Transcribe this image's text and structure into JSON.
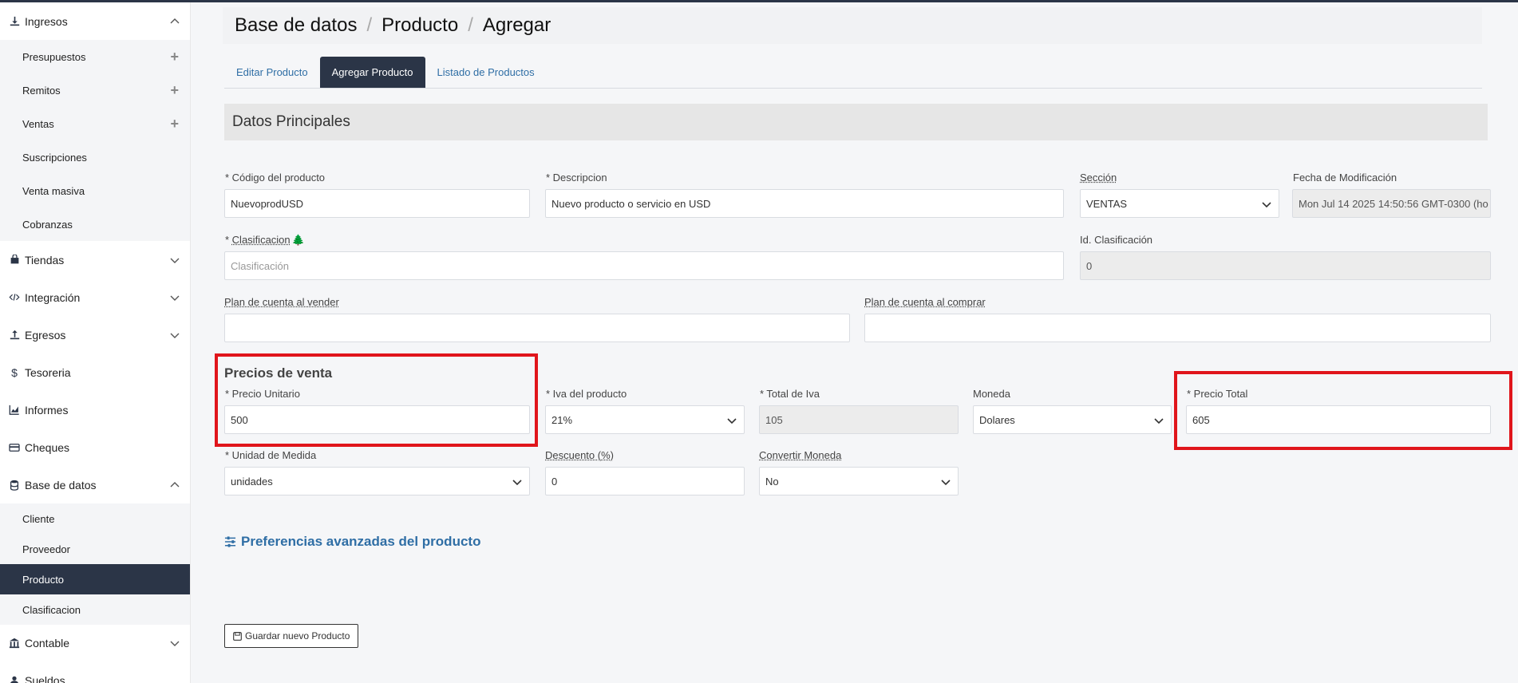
{
  "sidebar": {
    "items": [
      {
        "label": "Ingresos",
        "icon": "download-icon",
        "expanded": true
      },
      {
        "label": "Tiendas",
        "icon": "shop-icon"
      },
      {
        "label": "Integración",
        "icon": "code-icon"
      },
      {
        "label": "Egresos",
        "icon": "upload-icon"
      },
      {
        "label": "Tesoreria",
        "icon": "dollar-icon"
      },
      {
        "label": "Informes",
        "icon": "chart-icon"
      },
      {
        "label": "Cheques",
        "icon": "credit-card-icon"
      },
      {
        "label": "Base de datos",
        "icon": "database-icon",
        "expanded": true
      },
      {
        "label": "Contable",
        "icon": "bank-icon"
      },
      {
        "label": "Sueldos",
        "icon": "user-icon"
      }
    ],
    "ingresos_sub": [
      {
        "label": "Presupuestos",
        "plus": true
      },
      {
        "label": "Remitos",
        "plus": true
      },
      {
        "label": "Ventas",
        "plus": true
      },
      {
        "label": "Suscripciones"
      },
      {
        "label": "Venta masiva"
      },
      {
        "label": "Cobranzas"
      }
    ],
    "basedatos_sub": [
      {
        "label": "Cliente"
      },
      {
        "label": "Proveedor"
      },
      {
        "label": "Producto",
        "active": true
      },
      {
        "label": "Clasificacion"
      }
    ]
  },
  "breadcrumb": {
    "part1": "Base de datos",
    "part2": "Producto",
    "part3": "Agregar",
    "separator": "/"
  },
  "tabs": [
    {
      "label": "Editar Producto"
    },
    {
      "label": "Agregar Producto",
      "active": true
    },
    {
      "label": "Listado de Productos"
    }
  ],
  "section_title": "Datos Principales",
  "form": {
    "codigo": {
      "label": "* Código del producto",
      "value": "NuevoprodUSD"
    },
    "descripcion": {
      "label": "* Descripcion",
      "value": "Nuevo producto o servicio en USD"
    },
    "seccion": {
      "label": "Sección",
      "value": "VENTAS"
    },
    "fecha_mod": {
      "label": "Fecha de Modificación",
      "value": "Mon Jul 14 2025 14:50:56 GMT-0300 (ho"
    },
    "clasificacion": {
      "label_prefix": "* ",
      "label": "Clasificacion",
      "placeholder": "Clasificación"
    },
    "id_clasificacion": {
      "label": "Id. Clasificación",
      "value": "0"
    },
    "plan_vender": {
      "label": "Plan de cuenta al vender",
      "value": ""
    },
    "plan_comprar": {
      "label": "Plan de cuenta al comprar",
      "value": ""
    },
    "precios_title": "Precios de venta",
    "precio_unitario": {
      "label": "* Precio Unitario",
      "value": "500"
    },
    "iva_producto": {
      "label": "* Iva del producto",
      "value": "21%"
    },
    "total_iva": {
      "label": "* Total de Iva",
      "value": "105"
    },
    "moneda": {
      "label": "Moneda",
      "value": "Dolares"
    },
    "precio_total": {
      "label": "* Precio Total",
      "value": "605"
    },
    "unidad_medida": {
      "label": "* Unidad de Medida",
      "value": "unidades"
    },
    "descuento": {
      "label": "Descuento (%)",
      "value": "0"
    },
    "convertir_moneda": {
      "label": "Convertir Moneda",
      "value": "No"
    }
  },
  "advanced_link": "Preferencias avanzadas del producto",
  "save_button": "Guardar nuevo Producto",
  "colors": {
    "highlight": "#e0151b",
    "accent": "#2f6ea5",
    "dark": "#2b3547"
  }
}
